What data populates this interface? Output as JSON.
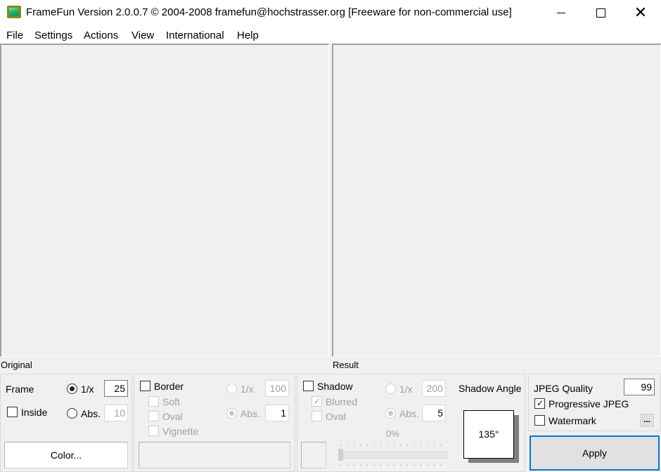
{
  "window": {
    "title": "FrameFun Version 2.0.0.7 © 2004-2008 framefun@hochstrasser.org [Freeware for non-commercial use]",
    "icon": "framefun-app-icon",
    "controls": {
      "minimize": "minimize-icon",
      "maximize": "maximize-icon",
      "close": "✕"
    }
  },
  "menu": [
    "File",
    "Settings",
    "Actions",
    "View",
    "International",
    "Help"
  ],
  "panes": {
    "original_label": "Original",
    "result_label": "Result"
  },
  "frame_group": {
    "title": "Frame",
    "inside_label": "Inside",
    "inside_checked": false,
    "ratio_label": "1/x",
    "ratio_selected": true,
    "ratio_value": "25",
    "abs_label": "Abs.",
    "abs_selected": false,
    "abs_value": "10",
    "color_button": "Color..."
  },
  "border_group": {
    "title": "Border",
    "checked": false,
    "soft_label": "Soft",
    "oval_label": "Oval",
    "vignette_label": "Vignette",
    "ratio_label": "1/x",
    "ratio_value": "100",
    "abs_label": "Abs.",
    "abs_selected": true,
    "abs_value": "1"
  },
  "shadow_group": {
    "title": "Shadow",
    "checked": false,
    "blurred_label": "Blurred",
    "blurred_checked": true,
    "oval_label": "Oval",
    "ratio_label": "1/x",
    "ratio_value": "200",
    "abs_label": "Abs.",
    "abs_selected": true,
    "abs_value": "5",
    "opacity_label": "0%",
    "opacity_value": 0,
    "angle_label": "Shadow Angle",
    "angle_value": "135°"
  },
  "output_group": {
    "jpeg_quality_label": "JPEG Quality",
    "jpeg_quality_value": "99",
    "progressive_label": "Progressive JPEG",
    "progressive_checked": true,
    "watermark_label": "Watermark",
    "watermark_checked": false,
    "watermark_options_button": "...",
    "apply_button": "Apply"
  },
  "colors": {
    "accent_focus": "#0078d7",
    "background": "#f0f0f0"
  }
}
